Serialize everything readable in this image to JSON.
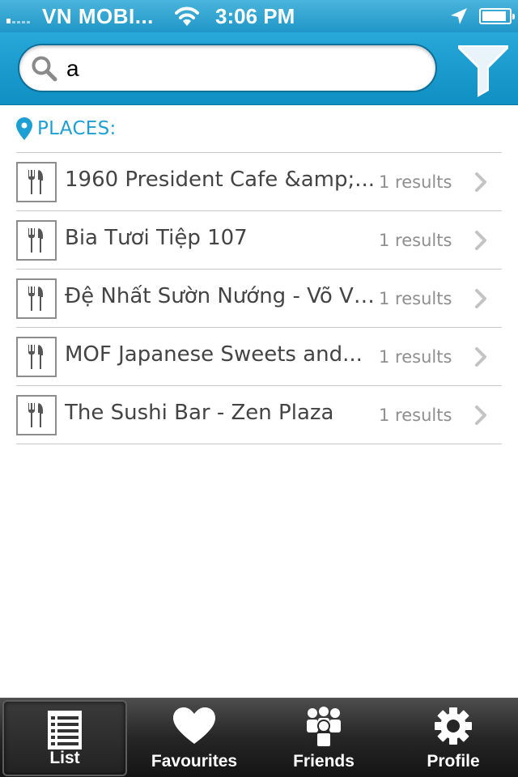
{
  "status_bar": {
    "carrier": "VN MOBI...",
    "time": "3:06 PM",
    "signal_bars": 1,
    "battery_level": 0.9
  },
  "search": {
    "value": "a",
    "icon": "search-icon",
    "filter_icon": "filter-icon"
  },
  "section": {
    "title": "PLACES:",
    "icon": "map-pin-icon"
  },
  "places": [
    {
      "name": "1960 President Cafe &amp;...",
      "count": "1 results",
      "icon": "fork-knife-icon"
    },
    {
      "name": "Bia Tươi Tiệp 107",
      "count": "1 results",
      "icon": "fork-knife-icon"
    },
    {
      "name": "Đệ Nhất Sườn Nướng - Võ Vă...",
      "count": "1 results",
      "icon": "fork-knife-icon"
    },
    {
      "name": "MOF Japanese Sweets and...",
      "count": "1 results",
      "icon": "fork-knife-icon"
    },
    {
      "name": "The Sushi Bar - Zen Plaza",
      "count": "1 results",
      "icon": "fork-knife-icon"
    }
  ],
  "tabs": [
    {
      "label": "List",
      "icon": "list-icon",
      "active": true
    },
    {
      "label": "Favourites",
      "icon": "heart-icon",
      "active": false
    },
    {
      "label": "Friends",
      "icon": "friends-icon",
      "active": false
    },
    {
      "label": "Profile",
      "icon": "gear-icon",
      "active": false
    }
  ],
  "colors": {
    "accent": "#1e9fd3",
    "header": "#1a9dd0",
    "tab_bar": "#262626"
  }
}
